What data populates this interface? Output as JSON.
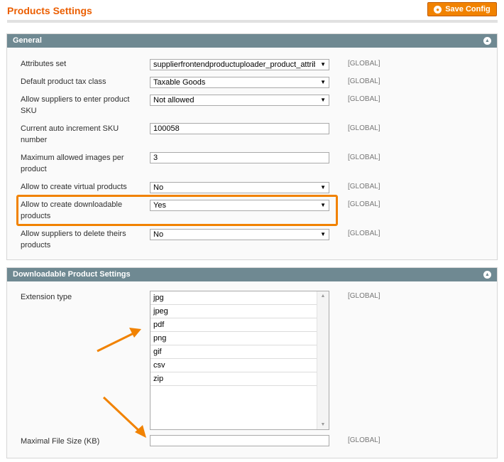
{
  "page": {
    "title": "Products Settings",
    "save_label": "Save Config"
  },
  "colors": {
    "accent": "#eb5e00",
    "button": "#f18200",
    "section_header": "#6f8992",
    "highlight": "#f18200"
  },
  "general": {
    "header": "General",
    "rows": [
      {
        "label": "Attributes set",
        "type": "select",
        "value": "supplierfrontendproductuploader_product_attribute",
        "scope": "[GLOBAL]"
      },
      {
        "label": "Default product tax class",
        "type": "select",
        "value": "Taxable Goods",
        "scope": "[GLOBAL]"
      },
      {
        "label": "Allow suppliers to enter product SKU",
        "type": "select",
        "value": "Not allowed",
        "scope": "[GLOBAL]"
      },
      {
        "label": "Current auto increment SKU number",
        "type": "text",
        "value": "100058",
        "scope": "[GLOBAL]"
      },
      {
        "label": "Maximum allowed images per product",
        "type": "text",
        "value": "3",
        "scope": "[GLOBAL]"
      },
      {
        "label": "Allow to create virtual products",
        "type": "select",
        "value": "No",
        "scope": "[GLOBAL]"
      },
      {
        "label": "Allow to create downloadable products",
        "type": "select",
        "value": "Yes",
        "scope": "[GLOBAL]",
        "highlighted": true
      },
      {
        "label": "Allow suppliers to delete theirs products",
        "type": "select",
        "value": "No",
        "scope": "[GLOBAL]"
      }
    ]
  },
  "downloadable": {
    "header": "Downloadable Product Settings",
    "extension_label": "Extension type",
    "extension_options": [
      "jpg",
      "jpeg",
      "pdf",
      "png",
      "gif",
      "csv",
      "zip"
    ],
    "extension_scope": "[GLOBAL]",
    "max_size_label": "Maximal File Size (KB)",
    "max_size_value": "",
    "max_size_scope": "[GLOBAL]"
  },
  "icons": {
    "save": "save-icon",
    "collapse": "collapse-up-icon",
    "dropdown": "chevron-down-icon",
    "annotation": "annotation-arrow-icon"
  }
}
